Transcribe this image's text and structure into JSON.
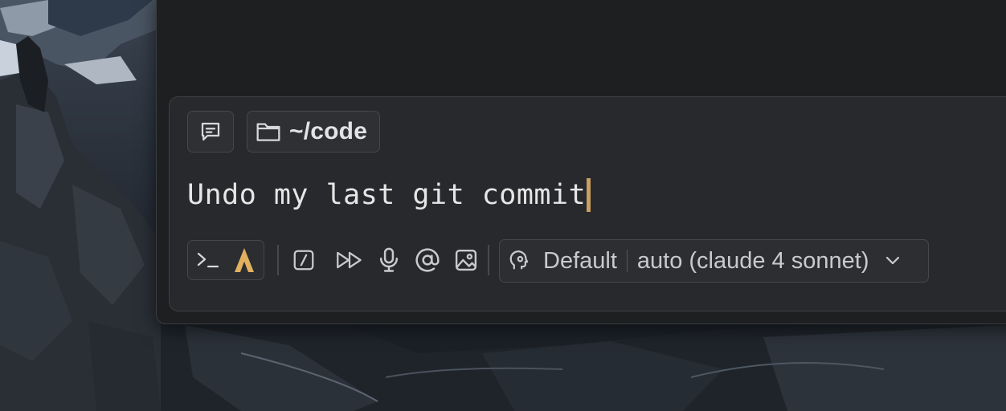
{
  "window": {
    "working_directory": "~/code",
    "prompt_text": "Undo my last git commit",
    "toolbar": {
      "profile_label": "Default",
      "model_label": "auto (claude 4 sonnet)"
    }
  },
  "icons": {
    "conversation": "message-square-icon",
    "folder": "folder-icon",
    "terminal": "terminal-icon",
    "agent": "agent-mode-icon",
    "slash": "slash-command-icon",
    "fast_forward": "fast-forward-icon",
    "mic": "microphone-icon",
    "mention": "at-sign-icon",
    "image": "image-icon",
    "profile": "profile-icon",
    "dropdown": "chevron-down-icon"
  },
  "colors": {
    "caret": "#c9a061",
    "agent_icon": "#e1b15f",
    "panel_bg": "#28292c",
    "window_bg": "#1e1f21"
  }
}
